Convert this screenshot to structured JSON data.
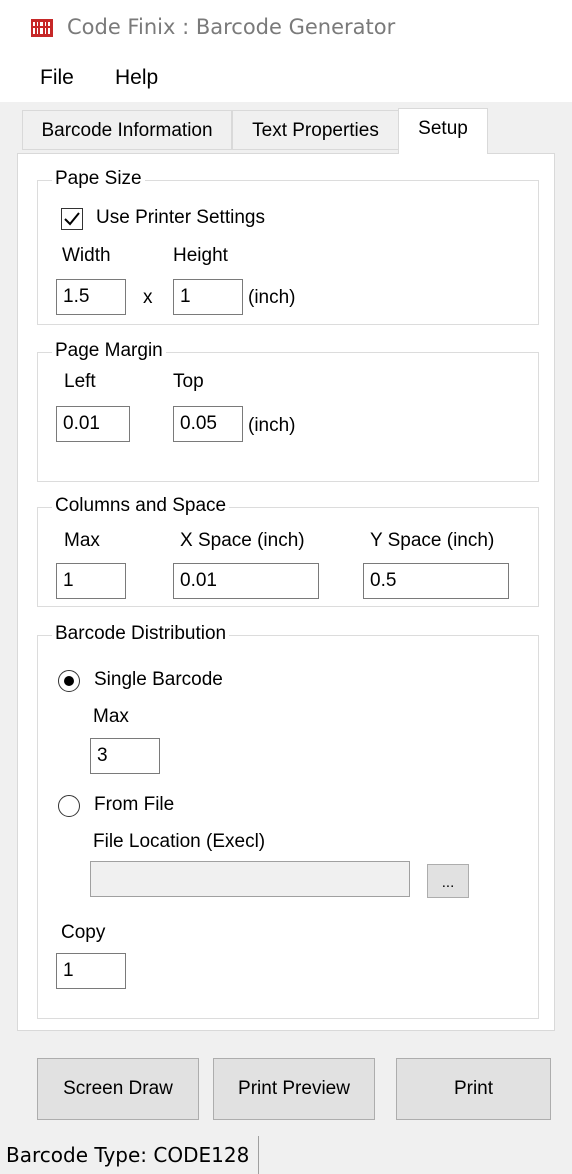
{
  "window": {
    "title": "Code Finix : Barcode Generator",
    "app_icon": "barcode-app-icon"
  },
  "menu": {
    "items": [
      {
        "label": "File"
      },
      {
        "label": "Help"
      }
    ]
  },
  "tabs": [
    {
      "label": "Barcode Information",
      "active": false
    },
    {
      "label": "Text Properties",
      "active": false
    },
    {
      "label": "Setup",
      "active": true
    }
  ],
  "setup": {
    "paper_size": {
      "title": "Pape Size",
      "use_printer_label": "Use Printer Settings",
      "use_printer_checked": true,
      "width_label": "Width",
      "height_label": "Height",
      "width_value": "1.5",
      "x_label": "x",
      "height_value": "1",
      "unit": "(inch)"
    },
    "page_margin": {
      "title": "Page Margin",
      "left_label": "Left",
      "top_label": "Top",
      "left_value": "0.01",
      "top_value": "0.05",
      "unit": "(inch)"
    },
    "columns": {
      "title": "Columns and Space",
      "max_label": "Max",
      "xspace_label": "X Space (inch)",
      "yspace_label": "Y Space (inch)",
      "max_value": "1",
      "xspace_value": "0.01",
      "yspace_value": "0.5"
    },
    "distribution": {
      "title": "Barcode Distribution",
      "single_label": "Single Barcode",
      "single_selected": true,
      "max_label": "Max",
      "max_value": "3",
      "file_label": "From File",
      "file_selected": false,
      "file_location_label": "File Location (Execl)",
      "file_location_value": "",
      "browse_label": "...",
      "copy_label": "Copy",
      "copy_value": "1"
    }
  },
  "buttons": {
    "screen_draw": "Screen Draw",
    "print_preview": "Print Preview",
    "print": "Print"
  },
  "status": {
    "text": "Barcode Type: CODE128"
  }
}
